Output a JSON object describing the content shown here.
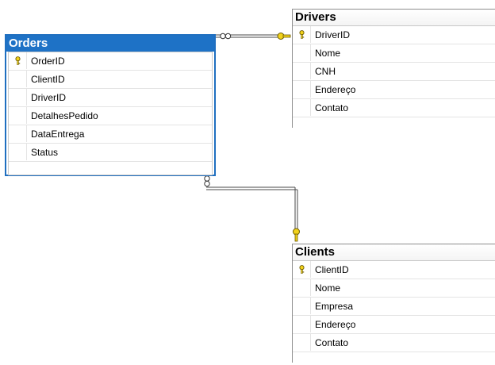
{
  "tables": {
    "orders": {
      "title": "Orders",
      "columns": [
        {
          "name": "OrderID",
          "primary_key": true
        },
        {
          "name": "ClientID",
          "primary_key": false
        },
        {
          "name": "DriverID",
          "primary_key": false
        },
        {
          "name": "DetalhesPedido",
          "primary_key": false
        },
        {
          "name": "DataEntrega",
          "primary_key": false
        },
        {
          "name": "Status",
          "primary_key": false
        }
      ]
    },
    "drivers": {
      "title": "Drivers",
      "columns": [
        {
          "name": "DriverID",
          "primary_key": true
        },
        {
          "name": "Nome",
          "primary_key": false
        },
        {
          "name": "CNH",
          "primary_key": false
        },
        {
          "name": "Endereço",
          "primary_key": false
        },
        {
          "name": "Contato",
          "primary_key": false
        }
      ]
    },
    "clients": {
      "title": "Clients",
      "columns": [
        {
          "name": "ClientID",
          "primary_key": true
        },
        {
          "name": "Nome",
          "primary_key": false
        },
        {
          "name": "Empresa",
          "primary_key": false
        },
        {
          "name": "Endereço",
          "primary_key": false
        },
        {
          "name": "Contato",
          "primary_key": false
        }
      ]
    }
  },
  "relationships": [
    {
      "from": "Orders",
      "to": "Drivers",
      "many_end": "Orders",
      "one_end": "Drivers"
    },
    {
      "from": "Orders",
      "to": "Clients",
      "many_end": "Orders",
      "one_end": "Clients"
    }
  ],
  "colors": {
    "selected_header": "#1e72c6",
    "key_icon": "#f2d21b",
    "connector": "#6e6e6e"
  }
}
